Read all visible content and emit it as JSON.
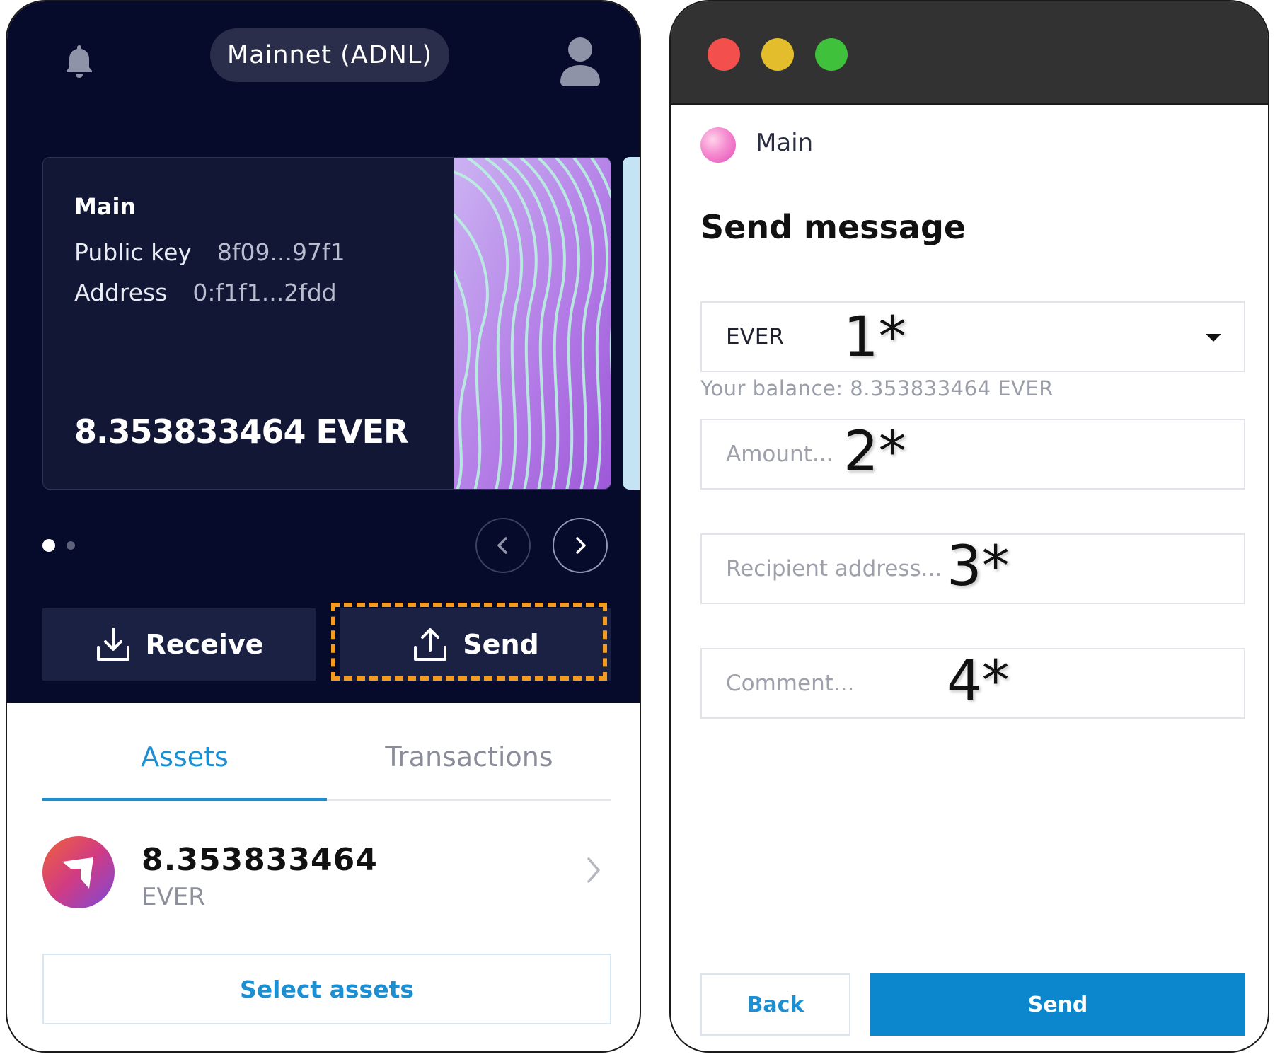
{
  "wallet": {
    "network": "Mainnet (ADNL)",
    "icons": {
      "notifications": "bell-icon",
      "profile": "user-icon"
    },
    "card": {
      "account_name": "Main",
      "public_key_label": "Public key",
      "public_key_value": "8f09...97f1",
      "address_label": "Address",
      "address_value": "0:f1f1...2fdd",
      "balance": "8.353833464 EVER"
    },
    "pagination": {
      "current": 1,
      "total": 2
    },
    "actions": {
      "receive_label": "Receive",
      "send_label": "Send"
    },
    "tabs": [
      {
        "label": "Assets",
        "active": true
      },
      {
        "label": "Transactions",
        "active": false
      }
    ],
    "assets": [
      {
        "amount": "8.353833464",
        "symbol": "EVER"
      }
    ],
    "select_assets_label": "Select assets",
    "colors": {
      "accent": "#1b8fd2",
      "dark_bg": "#060a2b",
      "highlight": "#f39a1f"
    }
  },
  "send_form": {
    "account_name": "Main",
    "title": "Send message",
    "token_select_value": "EVER",
    "balance_hint": "Your balance: 8.353833464 EVER",
    "amount_placeholder": "Amount...",
    "recipient_placeholder": "Recipient address...",
    "comment_placeholder": "Comment...",
    "markers": [
      "1*",
      "2*",
      "3*",
      "4*"
    ],
    "back_label": "Back",
    "send_label": "Send",
    "colors": {
      "primary": "#0c86cc",
      "titlebar": "#323232"
    }
  }
}
